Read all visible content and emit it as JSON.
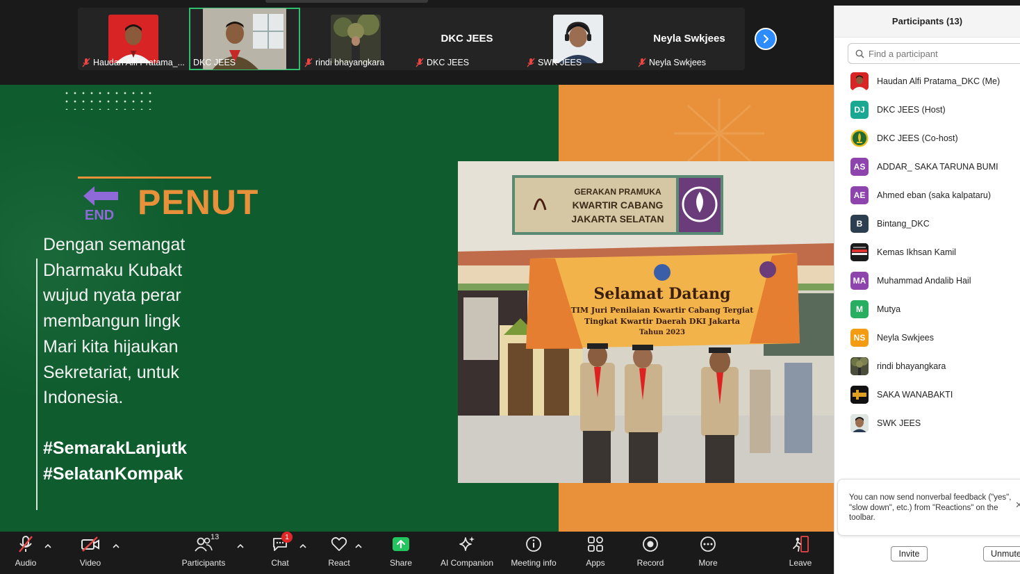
{
  "video_strip": {
    "tiles": [
      {
        "label": "Haudan Alfi Pratama_...",
        "big_name": "",
        "kind": "photo-red"
      },
      {
        "label": "DKC JEES",
        "big_name": "",
        "kind": "photo-room",
        "active": true
      },
      {
        "label": "rindi bhayangkara",
        "big_name": "",
        "kind": "photo-tree"
      },
      {
        "label": "DKC JEES",
        "big_name": "DKC JEES",
        "kind": "name"
      },
      {
        "label": "SWK JEES",
        "big_name": "",
        "kind": "photo-face"
      },
      {
        "label": "Neyla Swkjees",
        "big_name": "Neyla Swkjees",
        "kind": "name"
      }
    ]
  },
  "slide": {
    "title": "PENUT",
    "end_label": "END",
    "body_lines": [
      "Dengan semangat",
      "Dharmaku Kubakt",
      "wujud nyata perar",
      "membangun lingk",
      "Mari kita hijaukan",
      "Sekretariat, untuk",
      "Indonesia."
    ],
    "hashtags": [
      "#SemarakLanjutk",
      "#SelatanKompak"
    ],
    "photo": {
      "sign_lines": [
        "GERAKAN PRAMUKA",
        "KWARTIR CABANG",
        "JAKARTA SELATAN"
      ],
      "banner_title": "Selamat Datang",
      "banner_lines": [
        "TIM Juri Penilaian Kwartir Cabang Tergiat",
        "Tingkat Kwartir Daerah DKI Jakarta",
        "Tahun 2023"
      ]
    }
  },
  "toolbar": {
    "audio": "Audio",
    "video": "Video",
    "participants": "Participants",
    "participants_count": "13",
    "chat": "Chat",
    "chat_badge": "1",
    "react": "React",
    "share": "Share",
    "ai_companion": "AI Companion",
    "meeting_info": "Meeting info",
    "apps": "Apps",
    "record": "Record",
    "more": "More",
    "leave": "Leave"
  },
  "panel": {
    "title": "Participants (13)",
    "search_placeholder": "Find a participant",
    "participants": [
      {
        "name": "Haudan Alfi Pratama_DKC (Me)",
        "initials": "",
        "color": "#c8302c",
        "kind": "photo-red"
      },
      {
        "name": "DKC JEES (Host)",
        "initials": "DJ",
        "color": "#1aa893"
      },
      {
        "name": "DKC JEES (Co-host)",
        "initials": "",
        "color": "#1f6b33",
        "kind": "logo-green"
      },
      {
        "name": "ADDAR_ SAKA TARUNA BUMI",
        "initials": "AS",
        "color": "#8e44ad"
      },
      {
        "name": "Ahmed eban (saka kalpataru)",
        "initials": "AE",
        "color": "#8e44ad"
      },
      {
        "name": "Bintang_DKC",
        "initials": "B",
        "color": "#2c3e50"
      },
      {
        "name": "Kemas Ikhsan Kamil",
        "initials": "",
        "color": "#222222",
        "kind": "logo-dark"
      },
      {
        "name": "Muhammad Andalib Hail",
        "initials": "MA",
        "color": "#8e44ad"
      },
      {
        "name": "Mutya",
        "initials": "M",
        "color": "#27ae60"
      },
      {
        "name": "Neyla Swkjees",
        "initials": "NS",
        "color": "#f39c12"
      },
      {
        "name": "rindi bhayangkara",
        "initials": "",
        "color": "#6b6b4a",
        "kind": "photo-tree"
      },
      {
        "name": "SAKA WANABAKTI",
        "initials": "",
        "color": "#111111",
        "kind": "logo-black"
      },
      {
        "name": "SWK JEES",
        "initials": "",
        "color": "#7a8f7a",
        "kind": "photo-face"
      }
    ],
    "tip_text": "You can now send nonverbal feedback (\"yes\", \"slow down\", etc.) from \"Reactions\" on the toolbar.",
    "invite": "Invite",
    "unmute": "Unmute"
  },
  "colors": {
    "slide_green": "#0f5c2f",
    "slide_orange": "#e8913a",
    "zoom_blue": "#2d8cff",
    "active_green": "#2ebf6d"
  }
}
